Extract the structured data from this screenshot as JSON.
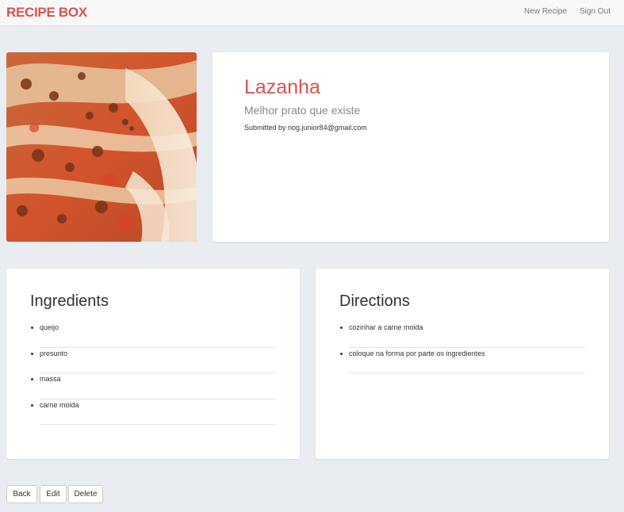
{
  "navbar": {
    "brand": "RECIPE BOX",
    "links": [
      "New Recipe",
      "Sign Out"
    ]
  },
  "recipe": {
    "image_alt": "lasagna-photo",
    "title": "Lazanha",
    "subtitle": "Melhor prato que existe",
    "submitted_by": "Submitted by nog.junior84@gmail.com"
  },
  "ingredients": {
    "title": "Ingredients",
    "items": [
      "queijo",
      "presunto",
      "massa",
      "carne moida"
    ]
  },
  "directions": {
    "title": "Directions",
    "items": [
      "cozinhar a carne moida",
      "coloque na forma por parte os ingredientes"
    ]
  },
  "actions": {
    "back": "Back",
    "edit": "Edit",
    "delete": "Delete"
  },
  "colors": {
    "accent": "#d9534f",
    "background": "#e9ecf0",
    "navbar": "#f8f8f8"
  }
}
